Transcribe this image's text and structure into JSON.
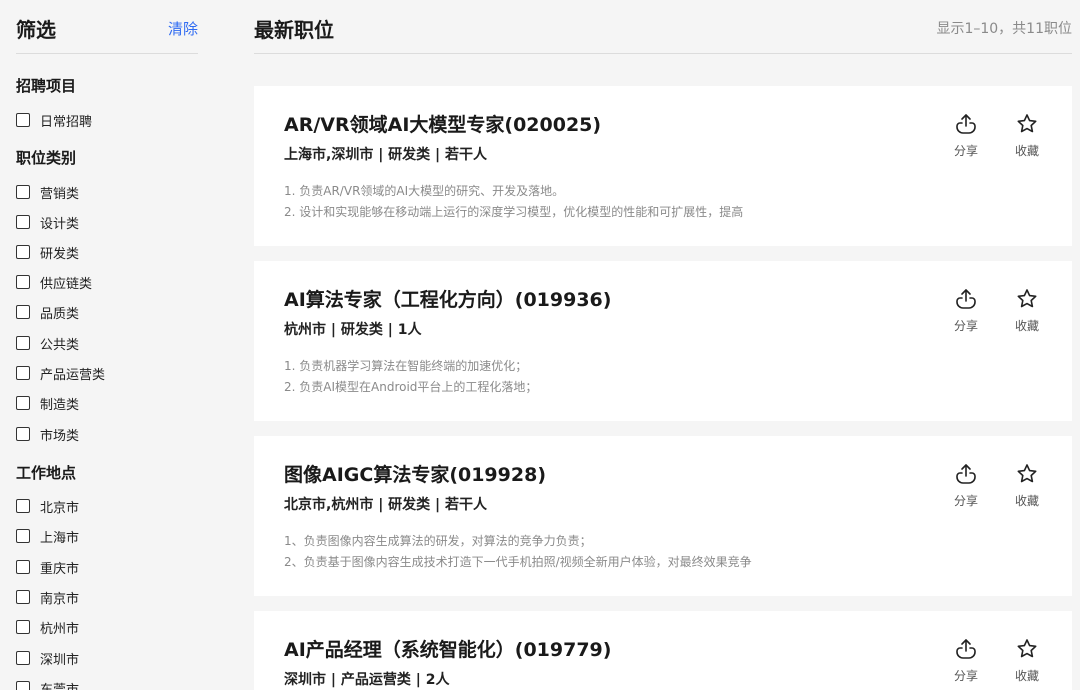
{
  "sidebar": {
    "title": "筛选",
    "clear_label": "清除",
    "groups": [
      {
        "title": "招聘项目",
        "options": [
          "日常招聘"
        ]
      },
      {
        "title": "职位类别",
        "options": [
          "营销类",
          "设计类",
          "研发类",
          "供应链类",
          "品质类",
          "公共类",
          "产品运营类",
          "制造类",
          "市场类"
        ]
      },
      {
        "title": "工作地点",
        "options": [
          "北京市",
          "上海市",
          "重庆市",
          "南京市",
          "杭州市",
          "深圳市",
          "东莞市"
        ]
      }
    ]
  },
  "main": {
    "title": "最新职位",
    "result_count": "显示1–10，共11职位",
    "share_label": "分享",
    "fav_label": "收藏",
    "jobs": [
      {
        "title": "AR/VR领域AI大模型专家(020025)",
        "meta": "上海市,深圳市 | 研发类 | 若干人",
        "desc": [
          "1. 负责AR/VR领域的AI大模型的研究、开发及落地。",
          "2. 设计和实现能够在移动端上运行的深度学习模型，优化模型的性能和可扩展性，提高"
        ]
      },
      {
        "title": "AI算法专家（工程化方向）(019936)",
        "meta": "杭州市 | 研发类 | 1人",
        "desc": [
          "1. 负责机器学习算法在智能终端的加速优化；",
          "2. 负责AI模型在Android平台上的工程化落地；"
        ]
      },
      {
        "title": "图像AIGC算法专家(019928)",
        "meta": "北京市,杭州市 | 研发类 | 若干人",
        "desc": [
          "1、负责图像内容生成算法的研发，对算法的竞争力负责；",
          "2、负责基于图像内容生成技术打造下一代手机拍照/视频全新用户体验，对最终效果竞争"
        ]
      },
      {
        "title": "AI产品经理（系统智能化）(019779)",
        "meta": "深圳市 | 产品运营类 | 2人",
        "desc": []
      }
    ]
  },
  "icons": {
    "share": "share-icon",
    "favorite": "star-outline-icon"
  },
  "colors": {
    "accent": "#2f6bf2",
    "background": "#f5f5f5",
    "card": "#ffffff",
    "muted": "#8a8a8a"
  }
}
